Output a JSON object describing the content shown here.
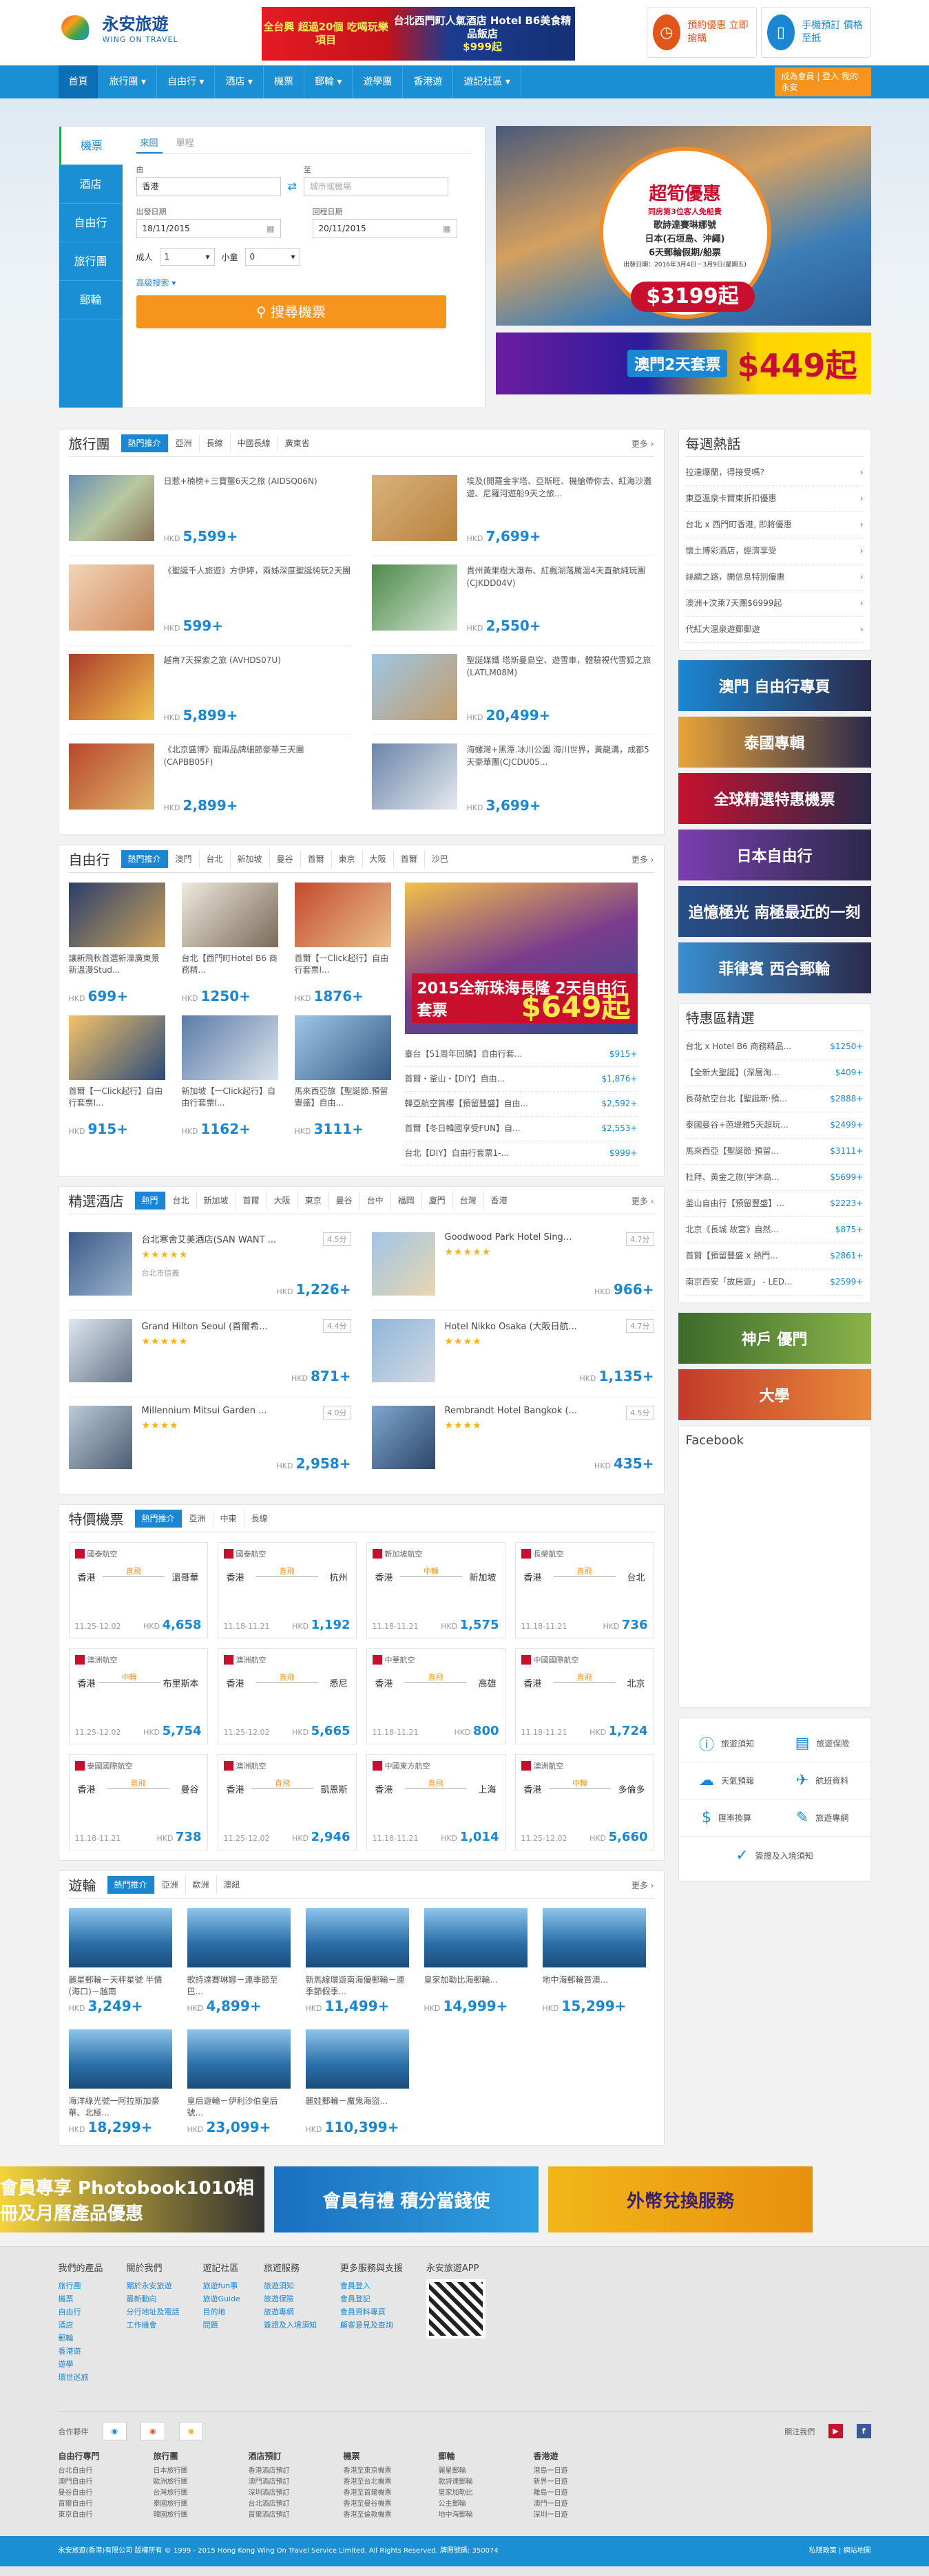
{
  "brand": {
    "name": "永安旅遊",
    "en": "WING ON TRAVEL"
  },
  "topad": {
    "left": "全台興 超過20個 吃喝玩樂項目",
    "right": "台北西門町人氣酒店 Hotel B6美食精品飯店",
    "price": "$999起"
  },
  "quick": [
    {
      "label": "預約優惠 立即搶購"
    },
    {
      "label": "手機預訂 價格至抵"
    }
  ],
  "nav": [
    "首頁",
    "旅行團",
    "自由行",
    "酒店",
    "機票",
    "郵輪",
    "遊學團",
    "香港遊",
    "遊記社區"
  ],
  "member": "成為會員 | 登入 我的永安",
  "search": {
    "tabs": [
      "機票",
      "酒店",
      "自由行",
      "旅行團",
      "郵輪"
    ],
    "subtabs": [
      "來回",
      "單程"
    ],
    "from_label": "由",
    "from": "香港",
    "to_label": "至",
    "to_ph": "城市或機場",
    "dep_label": "出發日期",
    "dep": "18/11/2015",
    "ret_label": "回程日期",
    "ret": "20/11/2015",
    "adult_label": "成人",
    "adult": "1",
    "child_label": "小童",
    "child": "0",
    "advanced": "高級搜索",
    "button": "搜尋機票"
  },
  "promo1": {
    "title": "超筍優惠",
    "sub": "同房第3位客人免船費",
    "lines": [
      "歌詩達賽琳娜號",
      "日本(石垣島、沖繩)",
      "6天郵輪假期/船票"
    ],
    "date": "出發日期：2016年3月4日－3月9日(星期五)",
    "price": "$3199起"
  },
  "promo2": {
    "label": "澳門2天套票",
    "price": "$449起"
  },
  "tours": {
    "title": "旅行團",
    "tabs": [
      "熱門推介",
      "亞洲",
      "長線",
      "中國長線",
      "廣東省"
    ],
    "more": "更多",
    "items": [
      {
        "name": "日惹+楠榜+三寶壟6天之旅 (AIDSQ06N)",
        "price": "5,599+"
      },
      {
        "name": "埃及(開羅金字塔、亞斯旺、機艙帶你去、紅海沙灘遊、尼羅河遊船9天之旅...",
        "price": "7,699+"
      },
      {
        "name": "《聖誕千人旅遊》方伊婷，兩姊深度聖誕純玩2天團",
        "price": "599+"
      },
      {
        "name": "貴州黃果樹大瀑布、紅楓湖落厲溫4天直航純玩團(CJKDD04V)",
        "price": "2,550+"
      },
      {
        "name": "越南7天探索之旅 (AVHDS07U)",
        "price": "5,899+"
      },
      {
        "name": "聖誕媒鐵 塔斯曼島空、遊雪車，體驗視代雪狐之旅(LATLM08M)",
        "price": "20,499+"
      },
      {
        "name": "《北京盛博》寵兩品牌細節豪華三天團(CAPBB05F)",
        "price": "2,899+"
      },
      {
        "name": "海螺灣+黑潭.冰川公園 海川世界，黃龍溝，成都5天豪華團(CJCDU05...",
        "price": "3,699+"
      }
    ]
  },
  "fit": {
    "title": "自由行",
    "tabs": [
      "熱門推介",
      "澳門",
      "台北",
      "新加坡",
      "曼谷",
      "首爾",
      "東京",
      "大阪",
      "首爾",
      "沙巴"
    ],
    "more": "更多",
    "cards": [
      {
        "name": "讓新飛秋首選新濠廣東景新溫漫Stud...",
        "price": "699+"
      },
      {
        "name": "台北【西門町Hotel B6 商務精...",
        "price": "1250+"
      },
      {
        "name": "首爾【一Click起行】自由行套票I...",
        "price": "1876+"
      },
      {
        "name": "首爾【一Click起行】自由行套票I...",
        "price": "915+"
      },
      {
        "name": "新加坡【一Click起行】自由行套票I...",
        "price": "1162+"
      },
      {
        "name": "馬來西亞旅【聖誕節.預留豐盛】自由...",
        "price": "3111+"
      }
    ],
    "big": {
      "title": "2015全新珠海長隆 2天自由行套票",
      "price": "$649起"
    },
    "list": [
      {
        "name": "臺台【51周年回饋】自由行套...",
        "price": "$915+"
      },
      {
        "name": "首爾・釜山・【DIY】自由...",
        "price": "$1,876+"
      },
      {
        "name": "韓亞航空賞櫻【預留豐盛】自由...",
        "price": "$2,592+"
      },
      {
        "name": "首爾【冬日韓國享受FUN】自...",
        "price": "$2,553+"
      },
      {
        "name": "台北【DIY】自由行套票1-...",
        "price": "$999+"
      }
    ]
  },
  "hotels": {
    "title": "精選酒店",
    "tabs": [
      "熱門",
      "台北",
      "新加坡",
      "首爾",
      "大阪",
      "東京",
      "曼谷",
      "台中",
      "福岡",
      "廈門",
      "台灣",
      "香港"
    ],
    "more": "更多",
    "items": [
      {
        "name": "台北寒舍艾美酒店(SAN WANT ...",
        "stars": "★★★★★",
        "score": "4.5分",
        "loc": "台北市信義",
        "price": "1,226+"
      },
      {
        "name": "Goodwood Park Hotel Sing...",
        "stars": "★★★★★",
        "score": "4.7分",
        "loc": "",
        "price": "966+"
      },
      {
        "name": "Grand Hilton Seoul (首爾希...",
        "stars": "★★★★★",
        "score": "4.4分",
        "loc": "",
        "price": "871+"
      },
      {
        "name": "Hotel Nikko Osaka (大阪日航...",
        "stars": "★★★★",
        "score": "4.7分",
        "loc": "",
        "price": "1,135+"
      },
      {
        "name": "Millennium Mitsui Garden ...",
        "stars": "★★★★",
        "score": "4.0分",
        "loc": "",
        "price": "2,958+"
      },
      {
        "name": "Rembrandt Hotel Bangkok (...",
        "stars": "★★★★",
        "score": "4.5分",
        "loc": "",
        "price": "435+"
      }
    ]
  },
  "air": {
    "title": "特價機票",
    "tabs": [
      "熱門推介",
      "亞洲",
      "中東",
      "長線"
    ],
    "items": [
      {
        "al": "國泰航空",
        "from": "香港",
        "to": "溫哥華",
        "type": "直飛",
        "date": "11.25-12.02",
        "price": "4,658"
      },
      {
        "al": "國泰航空",
        "from": "香港",
        "to": "杭州",
        "type": "直飛",
        "date": "11.18-11.21",
        "price": "1,192"
      },
      {
        "al": "新加坡航空",
        "from": "香港",
        "to": "新加坡",
        "type": "中轉",
        "date": "11.18-11.21",
        "price": "1,575"
      },
      {
        "al": "長榮航空",
        "from": "香港",
        "to": "台北",
        "type": "直飛",
        "date": "11.18-11.21",
        "price": "736"
      },
      {
        "al": "澳洲航空",
        "from": "香港",
        "to": "布里斯本",
        "type": "中轉",
        "date": "11.25-12.02",
        "price": "5,754"
      },
      {
        "al": "澳洲航空",
        "from": "香港",
        "to": "悉尼",
        "type": "直飛",
        "date": "11.25-12.02",
        "price": "5,665"
      },
      {
        "al": "中華航空",
        "from": "香港",
        "to": "高雄",
        "type": "直飛",
        "date": "11.18-11.21",
        "price": "800"
      },
      {
        "al": "中國國際航空",
        "from": "香港",
        "to": "北京",
        "type": "直飛",
        "date": "11.18-11.21",
        "price": "1,724"
      },
      {
        "al": "泰國國際航空",
        "from": "香港",
        "to": "曼谷",
        "type": "直飛",
        "date": "11.18-11.21",
        "price": "738"
      },
      {
        "al": "澳洲航空",
        "from": "香港",
        "to": "凱恩斯",
        "type": "直飛",
        "date": "11.25-12.02",
        "price": "2,946"
      },
      {
        "al": "中國東方航空",
        "from": "香港",
        "to": "上海",
        "type": "直飛",
        "date": "11.18-11.21",
        "price": "1,014"
      },
      {
        "al": "澳洲航空",
        "from": "香港",
        "to": "多倫多",
        "type": "中轉",
        "date": "11.25-12.02",
        "price": "5,660"
      }
    ]
  },
  "cruise": {
    "title": "遊輪",
    "tabs": [
      "熱門推介",
      "亞洲",
      "歐洲",
      "澳紐"
    ],
    "more": "更多",
    "items": [
      {
        "name": "麗星郵輪－天秤星號 半價(海口)－越南",
        "price": "3,249+"
      },
      {
        "name": "歌詩達賽琳娜－連季節至巴...",
        "price": "4,899+"
      },
      {
        "name": "新馬線環遊南海優郵輪－連季節假季...",
        "price": "11,499+"
      },
      {
        "name": "皇家加勒比海郵輪...",
        "price": "14,999+"
      },
      {
        "name": "地中海郵輪賞澳...",
        "price": "15,299+"
      },
      {
        "name": "海洋綠光號一阿拉斯加豪華、北極...",
        "price": "18,299+"
      },
      {
        "name": "皇后遊輪－伊利沙伯皇后號...",
        "price": "23,099+"
      },
      {
        "name": "麗娃郵輪－魔鬼海盜...",
        "price": "110,399+"
      }
    ]
  },
  "hot": {
    "title": "每週熱話",
    "items": [
      "拉達爆蘭，得接受嗎?",
      "東亞溫泉卡爾東折扣優惠",
      "台北 x 西門町香港, 即將優惠",
      "懷土博彩酒店，經濟享受",
      "絲綢之路，開信息特別優惠",
      "澳洲+汶萊7天團$6999起",
      "代紅大溫泉遊郵郵遊"
    ]
  },
  "side_banners": [
    "澳門 自由行專頁",
    "泰國專輯",
    "全球精選特惠機票",
    "日本自由行",
    "追憶極光 南極最近的一刻",
    "菲律賓 西合郵輪",
    "神戶 優門",
    "大學"
  ],
  "special": {
    "title": "特惠區精選",
    "items": [
      {
        "name": "台北 x Hotel B6 商務精品...",
        "price": "$1250+"
      },
      {
        "name": "【全新大聖誕】(深層淘...",
        "price": "$409+"
      },
      {
        "name": "長荷航空台北【聖誕新‧預...",
        "price": "$2888+"
      },
      {
        "name": "泰國曼谷+芭堤雅5天超玩...",
        "price": "$2499+"
      },
      {
        "name": "馬來西亞【聖誕節‧預留...",
        "price": "$3111+"
      },
      {
        "name": "杜拜、黃金之旅(宇沐高...",
        "price": "$5699+"
      },
      {
        "name": "釜山自由行【預留豐盛】...",
        "price": "$2223+"
      },
      {
        "name": "北京《長城 故宮》自然...",
        "price": "$875+"
      },
      {
        "name": "首爾【預留豐盛 x 熱門...",
        "price": "$2861+"
      },
      {
        "name": "南京西安「故居遊」 - LED...",
        "price": "$2599+"
      }
    ]
  },
  "fb": "Facebook",
  "services": [
    "旅遊須知",
    "旅遊保險",
    "天氣預報",
    "航班資料",
    "匯率換算",
    "旅遊專網",
    "簽證及入境須知"
  ],
  "btmads": [
    "會員專享 Photobook1010相冊及月曆產品優惠",
    "會員有禮 積分當錢使",
    "外幣兌換服務"
  ],
  "footer": {
    "cols": [
      {
        "h": "我們的產品",
        "items": [
          "旅行團",
          "機票",
          "自由行",
          "酒店",
          "郵輪",
          "香港遊",
          "遊學",
          "環世巡旅"
        ]
      },
      {
        "h": "關於我們",
        "items": [
          "關於永安旅遊",
          "最新動向",
          "分行地址及電話",
          "工作機會"
        ]
      },
      {
        "h": "遊記社區",
        "items": [
          "旅遊fun事",
          "旅遊Guide",
          "目的地",
          "問題"
        ]
      },
      {
        "h": "旅遊服務",
        "items": [
          "旅遊須知",
          "旅遊保險",
          "旅遊專網",
          "簽證及入境須知"
        ]
      },
      {
        "h": "更多服務與支援",
        "items": [
          "會員登入",
          "會員登記",
          "會員資料專頁",
          "顧客意見及查詢"
        ]
      },
      {
        "h": "永安旅遊APP",
        "items": []
      }
    ],
    "partners_label": "合作夥伴",
    "follow": "關注我們",
    "cols2": [
      {
        "h": "自由行專門",
        "items": [
          "台北自由行",
          "澳門自由行",
          "曼谷自由行",
          "首爾自由行",
          "東京自由行"
        ]
      },
      {
        "h": "旅行團",
        "items": [
          "日本旅行團",
          "歐洲旅行團",
          "台灣旅行團",
          "泰國旅行團",
          "韓國旅行團"
        ]
      },
      {
        "h": "酒店預訂",
        "items": [
          "香港酒店預訂",
          "澳門酒店預訂",
          "深圳酒店預訂",
          "台北酒店預訂",
          "首爾酒店預訂"
        ]
      },
      {
        "h": "機票",
        "items": [
          "香港至東京機票",
          "香港至台北機票",
          "香港至首爾機票",
          "香港至曼谷機票",
          "香港至倫敦機票"
        ]
      },
      {
        "h": "郵輪",
        "items": [
          "麗星郵輪",
          "歌詩達郵輪",
          "皇家加勒比",
          "公主郵輪",
          "地中海郵輪"
        ]
      },
      {
        "h": "香港遊",
        "items": [
          "港島一日遊",
          "新界一日遊",
          "離島一日遊",
          "澳門一日遊",
          "深圳一日遊"
        ]
      }
    ],
    "copy": "永安旅遊(香港)有限公司 版權所有 © 1999 - 2015 Hong Kong Wing On Travel Service Limited. All Rights Reserved. 牌照號碼: 350074",
    "copy_right": "私隱政策 | 網站地圖"
  }
}
